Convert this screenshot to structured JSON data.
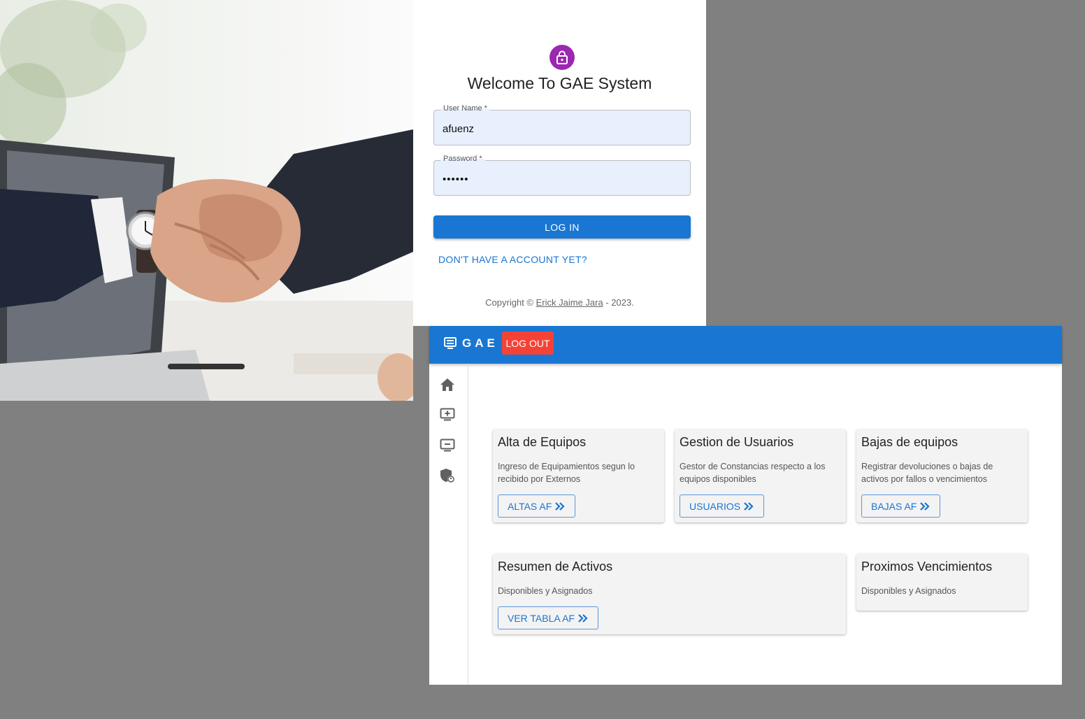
{
  "login": {
    "title": "Welcome To GAE System",
    "username_label": "User Name *",
    "username_value": "afuenz",
    "password_label": "Password *",
    "password_value": "afuenz",
    "login_button": "LOG IN",
    "signup_link": "DON'T HAVE A ACCOUNT YET?",
    "copyright_prefix": "Copyright ©",
    "copyright_author": "Erick Jaime Jara",
    "copyright_suffix": "- 2023."
  },
  "appbar": {
    "brand": "GAE",
    "logout_button": "LOG OUT",
    "color": "#1976d2"
  },
  "sidebar": {
    "items": [
      {
        "icon": "home-icon"
      },
      {
        "icon": "monitor-add-icon"
      },
      {
        "icon": "monitor-remove-icon"
      },
      {
        "icon": "shield-person-icon"
      }
    ]
  },
  "cards": [
    {
      "title": "Alta de Equipos",
      "description": "Ingreso de Equipamientos segun lo recibido por Externos",
      "button": "ALTAS AF"
    },
    {
      "title": "Gestion de Usuarios",
      "description": "Gestor de Constancias respecto a los equipos disponibles",
      "button": "USUARIOS"
    },
    {
      "title": "Bajas de equipos",
      "description": "Registrar devoluciones o bajas de activos por fallos o vencimientos",
      "button": "BAJAS AF"
    },
    {
      "title": "Resumen de Activos",
      "description": "Disponibles y Asignados",
      "button": "VER TABLA AF"
    },
    {
      "title": "Proximos Vencimientos",
      "description": "Disponibles y Asignados"
    }
  ],
  "colors": {
    "primary": "#1976d2",
    "danger": "#f44336",
    "avatar": "#9c27b0"
  }
}
